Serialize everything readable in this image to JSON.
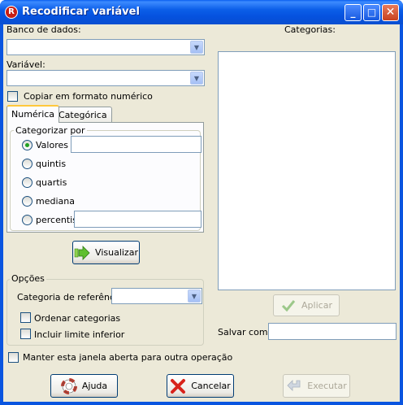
{
  "window": {
    "title": "Recodificar variável",
    "title_icon": "R",
    "controls": {
      "minimize": "_",
      "maximize": "□",
      "close": "✕"
    }
  },
  "database": {
    "label": "Banco de dados:",
    "value": ""
  },
  "variable": {
    "label": "Variável:",
    "value": ""
  },
  "copy_numeric": {
    "label": "Copiar em formato numérico",
    "checked": false
  },
  "tabs": [
    {
      "label": "Numérica",
      "active": true
    },
    {
      "label": "Categórica",
      "active": false
    }
  ],
  "categorize": {
    "title": "Categorizar por",
    "options": [
      {
        "label": "Valores",
        "selected": true
      },
      {
        "label": "quintis",
        "selected": false
      },
      {
        "label": "quartis",
        "selected": false
      },
      {
        "label": "mediana",
        "selected": false
      },
      {
        "label": "percentis",
        "selected": false
      }
    ]
  },
  "visualize_button": "Visualizar",
  "options": {
    "title": "Opções",
    "reference_label": "Categoria de referência",
    "reference_value": "",
    "sort_label": "Ordenar categorias",
    "include_lower_label": "Incluir limite inferior"
  },
  "categories": {
    "label": "Categorias:"
  },
  "apply_button": "Aplicar",
  "save_as": {
    "label": "Salvar como:",
    "value": ""
  },
  "keep_open": {
    "label": "Manter esta janela aberta para outra operação",
    "checked": false
  },
  "footer": {
    "help": "Ajuda",
    "cancel": "Cancelar",
    "execute": "Executar"
  },
  "colors": {
    "title_bar": "#0a55e0",
    "dialog_bg": "#ece9d8",
    "radio_dot": "#21a121",
    "cancel_icon": "#d8231c"
  }
}
